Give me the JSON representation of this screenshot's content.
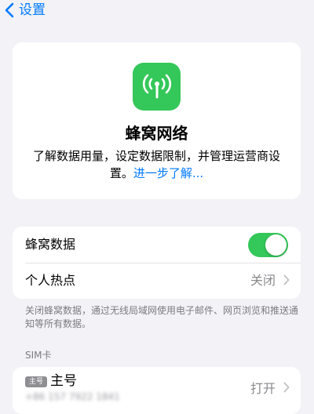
{
  "nav": {
    "back_label": "设置"
  },
  "hero": {
    "title": "蜂窝网络",
    "description": "了解数据用量，设定数据限制，并管理运营商设置。",
    "learn_more": "进一步了解..."
  },
  "settings": {
    "cellular_data": {
      "label": "蜂窝数据",
      "enabled": true
    },
    "hotspot": {
      "label": "个人热点",
      "value": "关闭"
    }
  },
  "footnote": "关闭蜂窝数据，通过无线局域网使用电子邮件、网页浏览和推送通知等所有数据。",
  "sim_section": {
    "header": "SIM卡",
    "primary": {
      "badge": "主号",
      "name": "主号",
      "number": "+86 157 7922 1841",
      "value": "打开"
    }
  },
  "colors": {
    "accent": "#007aff",
    "green": "#34c759"
  }
}
